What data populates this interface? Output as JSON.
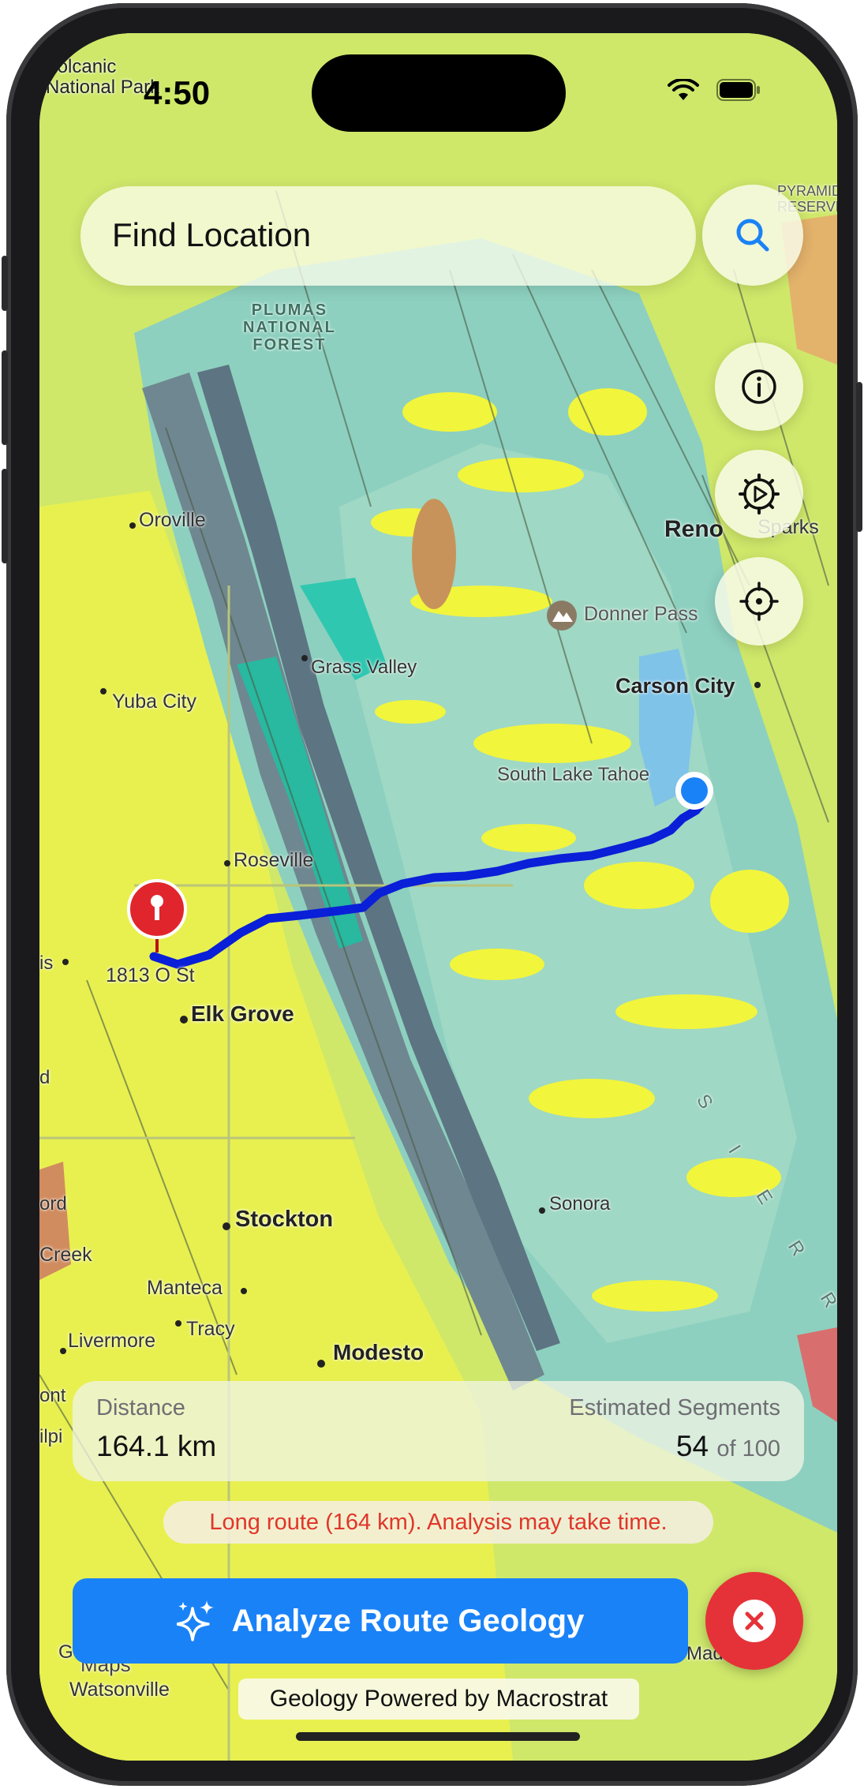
{
  "status_bar": {
    "time": "4:50"
  },
  "search": {
    "placeholder": "Find Location"
  },
  "map": {
    "places": {
      "volcanic_park": "Volcanic\nNational Park",
      "plumas": "PLUMAS\nNATIONAL\nFOREST",
      "oroville": "Oroville",
      "reno": "Reno",
      "sparks": "Sparks",
      "donner": "Donner Pass",
      "grass_valley": "Grass Valley",
      "yuba": "Yuba City",
      "carson": "Carson City",
      "south_lake_tahoe": "South Lake Tahoe",
      "roseville": "Roseville",
      "address": "1813 O St",
      "elk_grove": "Elk Grove",
      "stockton": "Stockton",
      "sonora": "Sonora",
      "manteca": "Manteca",
      "tracy": "Tracy",
      "livermore": "Livermore",
      "modesto": "Modesto",
      "creek": "Creek",
      "watsonville": "Watsonville",
      "sierra": "SIERRA NE",
      "pyramid": "PYRAMID RESERVE",
      "left_is": "is",
      "left_d": "d",
      "left_ord": "ord",
      "left_ont": "ont",
      "left_ilpi": "ilpi",
      "left_g": "G",
      "mad": "Mad",
      "maps": "Maps"
    }
  },
  "stats": {
    "distance_label": "Distance",
    "distance_value": "164.1 km",
    "segments_label": "Estimated Segments",
    "segments_value": "54",
    "segments_total": "of 100"
  },
  "warning": "Long route (164 km). Analysis may take time.",
  "analyze_button": "Analyze Route Geology",
  "attribution": "Geology Powered by Macrostrat",
  "colors": {
    "map_base": "#c9e96a",
    "accent_blue": "#1a82f7",
    "route": "#0a1fd8",
    "cancel_red": "#e53238",
    "warning_red": "#e0362b"
  }
}
